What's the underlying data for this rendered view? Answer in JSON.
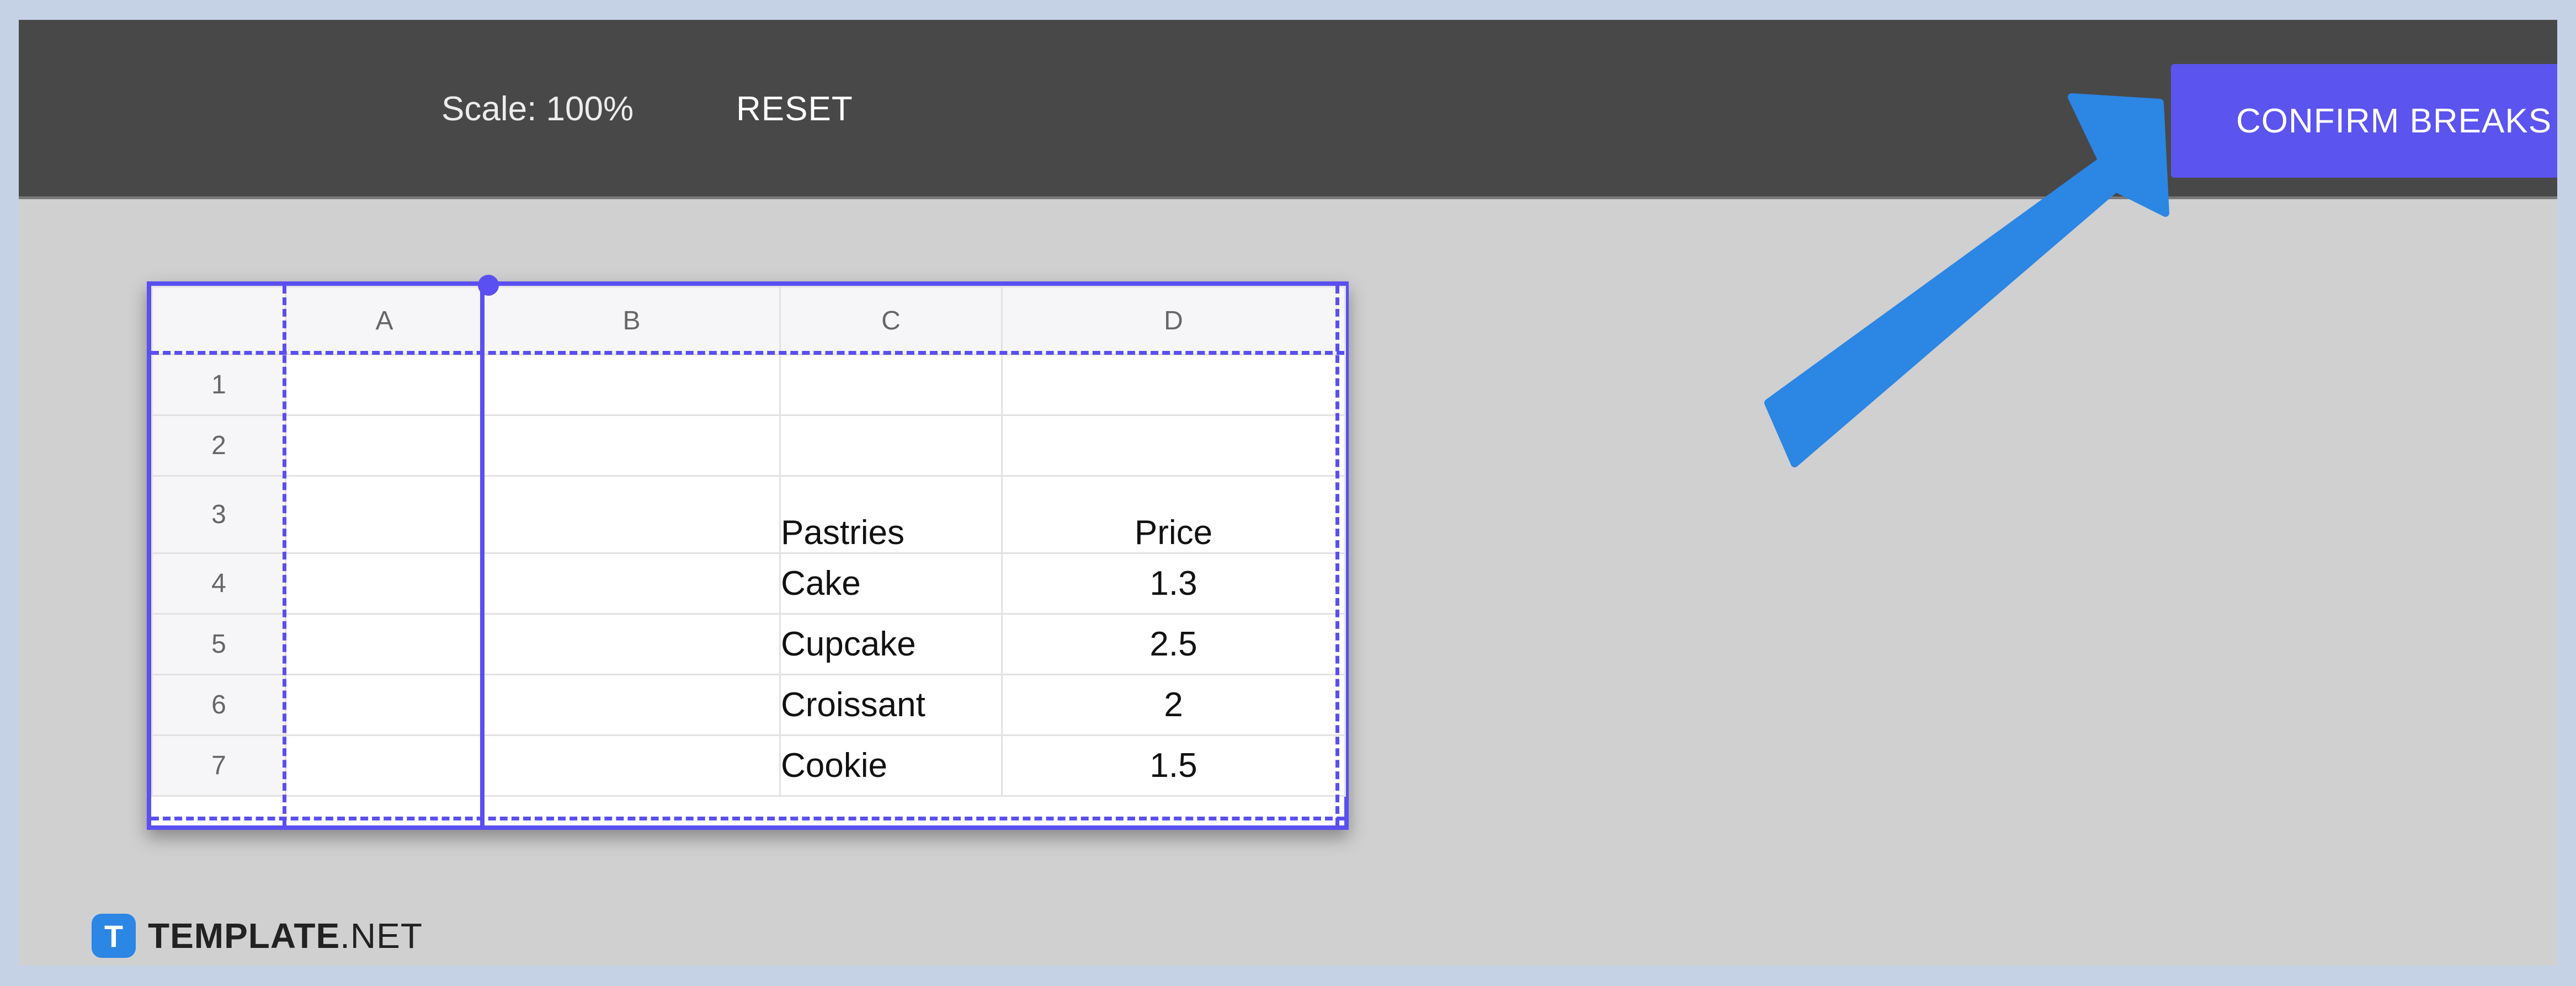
{
  "toolbar": {
    "scale_label": "Scale: 100%",
    "reset_label": "RESET",
    "confirm_label": "CONFIRM BREAKS"
  },
  "sheet": {
    "columns": [
      "A",
      "B",
      "C",
      "D"
    ],
    "rows": [
      {
        "num": "1",
        "C": "",
        "D": ""
      },
      {
        "num": "2",
        "C": "",
        "D": ""
      },
      {
        "num": "3",
        "C": "Pastries",
        "D": "Price"
      },
      {
        "num": "4",
        "C": "Cake",
        "D": "1.3"
      },
      {
        "num": "5",
        "C": "Cupcake",
        "D": "2.5"
      },
      {
        "num": "6",
        "C": "Croissant",
        "D": "2"
      },
      {
        "num": "7",
        "C": "Cookie",
        "D": "1.5"
      }
    ]
  },
  "watermark": {
    "badge": "T",
    "brand_bold": "TEMPLATE",
    "brand_rest": ".NET"
  },
  "colors": {
    "toolbar_bg": "#484848",
    "accent": "#5b54ee",
    "arrow": "#2b86e4",
    "canvas_bg": "#d0d0d0"
  }
}
